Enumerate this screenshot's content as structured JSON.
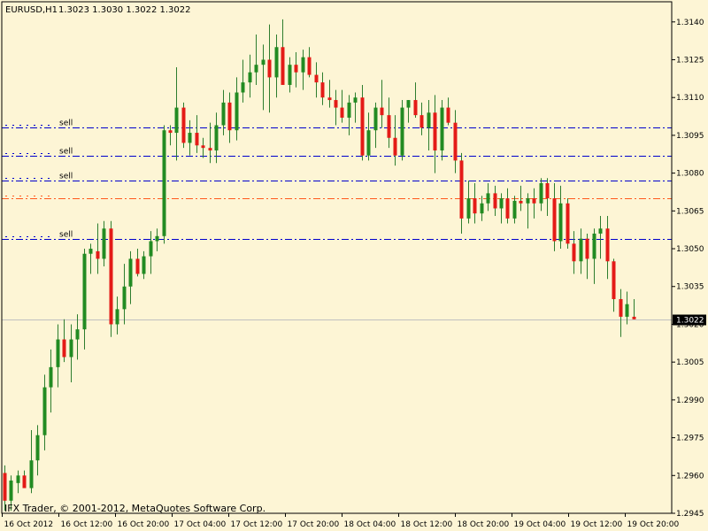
{
  "header": {
    "symbol_timeframe": "EURUSD,H1",
    "ohlc": "1.3023 1.3030 1.3022 1.3022"
  },
  "footer": {
    "copyright": "IFX Trader, © 2001-2012, MetaQuotes Software Corp."
  },
  "colors": {
    "background": "#fdf5d5",
    "axis": "#000000",
    "bull": "#228b22",
    "bear": "#e41b17",
    "wick": "#2e7d2e",
    "order_line": "#0000cd",
    "bid_line": "#c0c0c0",
    "stop_line": "#ff5a1e"
  },
  "chart_data": {
    "type": "candlestick",
    "symbol": "EURUSD",
    "timeframe": "H1",
    "ylim": [
      1.2945,
      1.3148
    ],
    "y_ticks": [
      "1.3140",
      "1.3125",
      "1.3110",
      "1.3095",
      "1.3080",
      "1.3065",
      "1.3050",
      "1.3035",
      "1.3020",
      "1.3005",
      "1.2990",
      "1.2975",
      "1.2960",
      "1.2945"
    ],
    "x_ticks": [
      "16 Oct 2012",
      "16 Oct 12:00",
      "16 Oct 20:00",
      "17 Oct 04:00",
      "17 Oct 12:00",
      "17 Oct 20:00",
      "18 Oct 04:00",
      "18 Oct 12:00",
      "18 Oct 20:00",
      "19 Oct 04:00",
      "19 Oct 12:00",
      "19 Oct 20:00"
    ],
    "current_price": "1.3022",
    "order_lines": [
      {
        "label": "sell",
        "price": 1.3098,
        "style": "dashdot",
        "color": "#0000cd"
      },
      {
        "label": "sell",
        "price": 1.3087,
        "style": "dashdot",
        "color": "#0000cd"
      },
      {
        "label": "sell",
        "price": 1.3077,
        "style": "dashdot",
        "color": "#0000cd"
      },
      {
        "label": "",
        "price": 1.307,
        "style": "dashdot",
        "color": "#ff5a1e"
      },
      {
        "label": "sell",
        "price": 1.3054,
        "style": "dashdot",
        "color": "#0000cd"
      }
    ],
    "candles": [
      [
        1.2961,
        1.2964,
        1.2946,
        1.295
      ],
      [
        1.295,
        1.296,
        1.2946,
        1.2958
      ],
      [
        1.2957,
        1.2962,
        1.2953,
        1.296
      ],
      [
        1.296,
        1.2962,
        1.2955,
        1.2955
      ],
      [
        1.2955,
        1.2978,
        1.2953,
        1.2966
      ],
      [
        1.2966,
        1.298,
        1.296,
        1.2976
      ],
      [
        1.2976,
        1.3,
        1.297,
        1.2995
      ],
      [
        1.2995,
        1.301,
        1.2985,
        1.3003
      ],
      [
        1.3003,
        1.302,
        1.2995,
        1.3014
      ],
      [
        1.3014,
        1.3022,
        1.3005,
        1.3007
      ],
      [
        1.3007,
        1.302,
        1.2997,
        1.3014
      ],
      [
        1.3014,
        1.3024,
        1.3006,
        1.3018
      ],
      [
        1.3018,
        1.305,
        1.301,
        1.3048
      ],
      [
        1.3048,
        1.3052,
        1.304,
        1.305
      ],
      [
        1.3049,
        1.306,
        1.304,
        1.3046
      ],
      [
        1.3046,
        1.3061,
        1.3043,
        1.3058
      ],
      [
        1.3058,
        1.3061,
        1.3015,
        1.302
      ],
      [
        1.302,
        1.3031,
        1.3016,
        1.3026
      ],
      [
        1.3026,
        1.3044,
        1.302,
        1.3035
      ],
      [
        1.3035,
        1.3049,
        1.3028,
        1.3046
      ],
      [
        1.3046,
        1.305,
        1.3039,
        1.304
      ],
      [
        1.304,
        1.3049,
        1.3038,
        1.3047
      ],
      [
        1.3047,
        1.3057,
        1.304,
        1.3053
      ],
      [
        1.3053,
        1.3058,
        1.3049,
        1.3055
      ],
      [
        1.3055,
        1.3099,
        1.3052,
        1.3097
      ],
      [
        1.3097,
        1.3099,
        1.3091,
        1.3096
      ],
      [
        1.3096,
        1.3122,
        1.3085,
        1.3106
      ],
      [
        1.3106,
        1.3108,
        1.309,
        1.3092
      ],
      [
        1.3092,
        1.3101,
        1.3087,
        1.3096
      ],
      [
        1.3096,
        1.3103,
        1.3088,
        1.3091
      ],
      [
        1.3091,
        1.3094,
        1.3086,
        1.309
      ],
      [
        1.309,
        1.31,
        1.3084,
        1.3089
      ],
      [
        1.3089,
        1.3104,
        1.3084,
        1.3099
      ],
      [
        1.3099,
        1.3113,
        1.3095,
        1.3108
      ],
      [
        1.3108,
        1.3112,
        1.3092,
        1.3097
      ],
      [
        1.3097,
        1.3118,
        1.3093,
        1.3112
      ],
      [
        1.3112,
        1.3125,
        1.3108,
        1.3116
      ],
      [
        1.3116,
        1.3127,
        1.311,
        1.312
      ],
      [
        1.312,
        1.3135,
        1.3115,
        1.3123
      ],
      [
        1.3123,
        1.3131,
        1.3105,
        1.3125
      ],
      [
        1.3125,
        1.3139,
        1.3104,
        1.3118
      ],
      [
        1.3118,
        1.3135,
        1.311,
        1.313
      ],
      [
        1.313,
        1.3141,
        1.3116,
        1.3115
      ],
      [
        1.3115,
        1.3126,
        1.3112,
        1.3123
      ],
      [
        1.3123,
        1.3128,
        1.3114,
        1.312
      ],
      [
        1.312,
        1.3129,
        1.3113,
        1.3126
      ],
      [
        1.3126,
        1.313,
        1.3118,
        1.3119
      ],
      [
        1.3119,
        1.3124,
        1.311,
        1.3116
      ],
      [
        1.3116,
        1.312,
        1.3107,
        1.311
      ],
      [
        1.311,
        1.3117,
        1.3106,
        1.3109
      ],
      [
        1.3109,
        1.3113,
        1.3099,
        1.3106
      ],
      [
        1.3106,
        1.3113,
        1.31,
        1.3102
      ],
      [
        1.3102,
        1.3111,
        1.3095,
        1.3108
      ],
      [
        1.3108,
        1.3112,
        1.31,
        1.311
      ],
      [
        1.311,
        1.3115,
        1.3085,
        1.3087
      ],
      [
        1.3087,
        1.3104,
        1.3085,
        1.3097
      ],
      [
        1.3097,
        1.3108,
        1.309,
        1.3106
      ],
      [
        1.3106,
        1.3117,
        1.3098,
        1.3103
      ],
      [
        1.3103,
        1.311,
        1.309,
        1.3094
      ],
      [
        1.3094,
        1.3103,
        1.3083,
        1.3087
      ],
      [
        1.3087,
        1.3109,
        1.3085,
        1.3106
      ],
      [
        1.3106,
        1.3109,
        1.31,
        1.3109
      ],
      [
        1.3109,
        1.3116,
        1.3102,
        1.3103
      ],
      [
        1.3103,
        1.3108,
        1.3095,
        1.3098
      ],
      [
        1.3098,
        1.3109,
        1.3089,
        1.3104
      ],
      [
        1.3104,
        1.3111,
        1.308,
        1.3089
      ],
      [
        1.3089,
        1.3109,
        1.3085,
        1.3106
      ],
      [
        1.3106,
        1.311,
        1.3099,
        1.31
      ],
      [
        1.31,
        1.3105,
        1.308,
        1.3085
      ],
      [
        1.3085,
        1.3088,
        1.3056,
        1.3062
      ],
      [
        1.3062,
        1.3077,
        1.306,
        1.307
      ],
      [
        1.307,
        1.3076,
        1.306,
        1.3064
      ],
      [
        1.3064,
        1.3071,
        1.3061,
        1.3068
      ],
      [
        1.3068,
        1.3076,
        1.3065,
        1.3072
      ],
      [
        1.3072,
        1.3075,
        1.3063,
        1.3066
      ],
      [
        1.3066,
        1.3072,
        1.306,
        1.307
      ],
      [
        1.307,
        1.3074,
        1.306,
        1.3062
      ],
      [
        1.3062,
        1.3071,
        1.306,
        1.3069
      ],
      [
        1.3069,
        1.3075,
        1.3065,
        1.3068
      ],
      [
        1.3068,
        1.3072,
        1.3058,
        1.307
      ],
      [
        1.307,
        1.3074,
        1.3062,
        1.3068
      ],
      [
        1.3068,
        1.3078,
        1.3065,
        1.3076
      ],
      [
        1.3076,
        1.3078,
        1.3063,
        1.307
      ],
      [
        1.307,
        1.3076,
        1.3049,
        1.3053
      ],
      [
        1.3053,
        1.3075,
        1.305,
        1.3068
      ],
      [
        1.3068,
        1.307,
        1.305,
        1.3052
      ],
      [
        1.3052,
        1.3057,
        1.304,
        1.3045
      ],
      [
        1.3045,
        1.3058,
        1.304,
        1.3054
      ],
      [
        1.3054,
        1.3056,
        1.3038,
        1.3046
      ],
      [
        1.3046,
        1.3058,
        1.3036,
        1.3056
      ],
      [
        1.3056,
        1.3063,
        1.3046,
        1.3058
      ],
      [
        1.3058,
        1.3063,
        1.3038,
        1.3045
      ],
      [
        1.3045,
        1.3046,
        1.3025,
        1.303
      ],
      [
        1.303,
        1.3034,
        1.3015,
        1.3023
      ],
      [
        1.3023,
        1.3033,
        1.302,
        1.3028
      ],
      [
        1.3023,
        1.303,
        1.3022,
        1.3022
      ]
    ]
  }
}
